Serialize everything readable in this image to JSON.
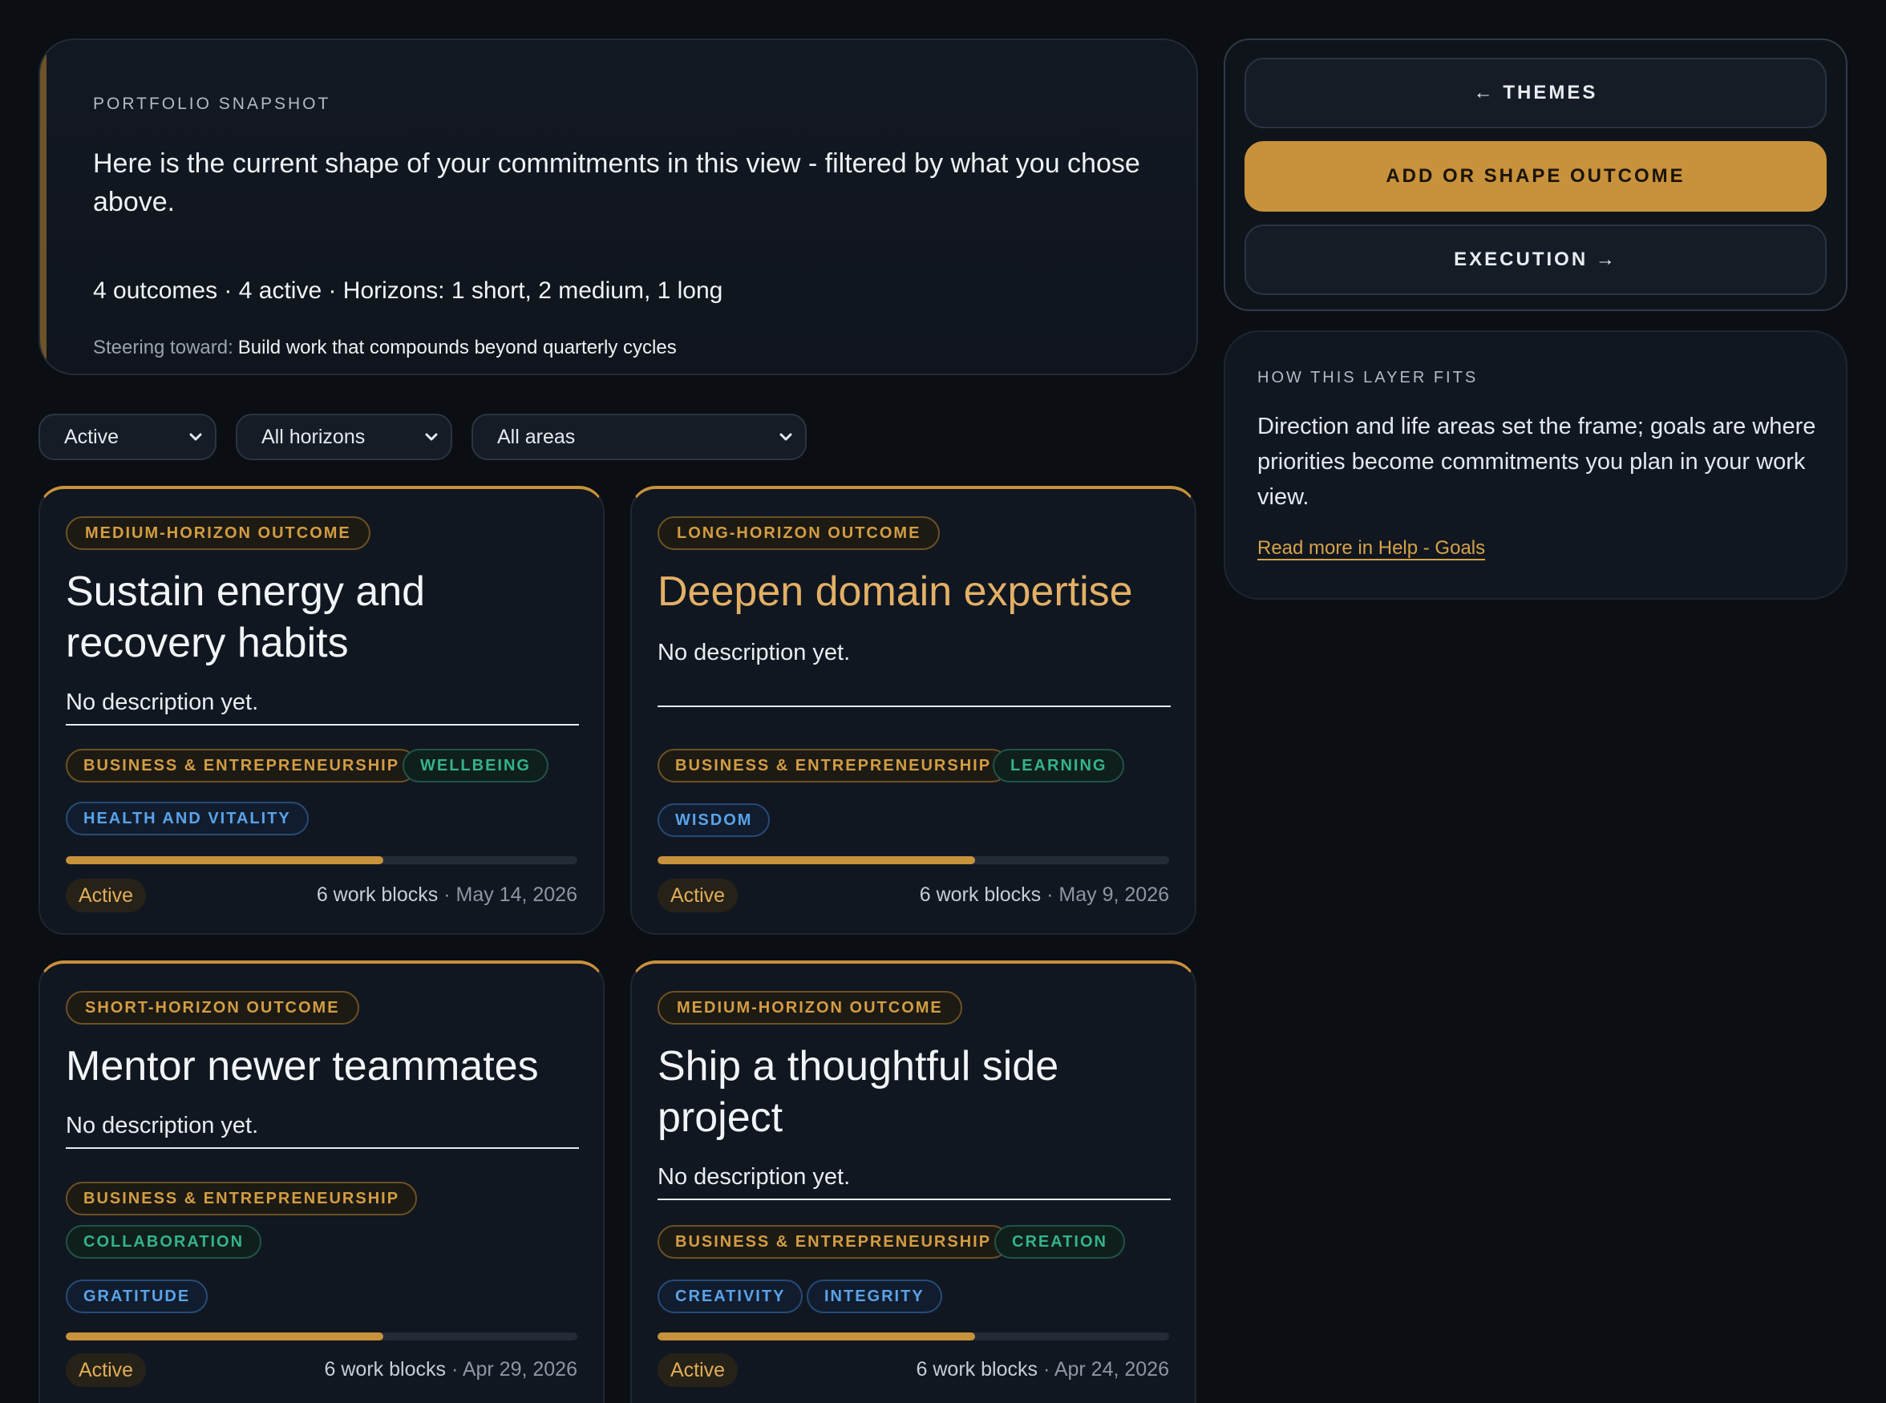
{
  "snapshot": {
    "eyebrow": "PORTFOLIO SNAPSHOT",
    "lead": "Here is the current shape of your commitments in this view - filtered by what you chose above.",
    "stats": "4 outcomes · 4 active · Horizons: 1 short, 2 medium, 1 long",
    "steer_label": "Steering toward:",
    "steer_value": "Build work that compounds beyond quarterly cycles"
  },
  "actions": {
    "themes": "← THEMES",
    "add": "ADD OR SHAPE OUTCOME",
    "execution": "EXECUTION →"
  },
  "fits": {
    "eyebrow": "HOW THIS LAYER FITS",
    "body": "Direction and life areas set the frame; goals are where priorities become commitments you plan in your work view.",
    "link": "Read more in Help - Goals"
  },
  "filters": {
    "status": "Active",
    "horizon": "All horizons",
    "area": "All areas"
  },
  "colors": {
    "accent": "#c8913b",
    "area_tag": "#d39d43",
    "focus_tag": "#34b38b",
    "value_tag": "#5aa3ea"
  },
  "cards": [
    {
      "badge": "MEDIUM-HORIZON OUTCOME",
      "title": "Sustain energy and recovery habits",
      "description": "No description yet.",
      "tags": [
        "BUSINESS & ENTREPRENEURSHIP",
        "WELLBEING",
        "HEALTH AND VITALITY"
      ],
      "progress": 0.62,
      "status": "Active",
      "blocks": "6 work blocks",
      "date": "· May 14, 2026"
    },
    {
      "badge": "LONG-HORIZON OUTCOME",
      "title": "Deepen domain expertise",
      "description": "No description yet.",
      "tags": [
        "BUSINESS & ENTREPRENEURSHIP",
        "LEARNING",
        "WISDOM"
      ],
      "progress": 0.62,
      "status": "Active",
      "blocks": "6 work blocks",
      "date": "· May 9, 2026"
    },
    {
      "badge": "SHORT-HORIZON OUTCOME",
      "title": "Mentor newer teammates",
      "description": "No description yet.",
      "tags": [
        "BUSINESS & ENTREPRENEURSHIP",
        "COLLABORATION",
        "GRATITUDE"
      ],
      "progress": 0.62,
      "status": "Active",
      "blocks": "6 work blocks",
      "date": "· Apr 29, 2026"
    },
    {
      "badge": "MEDIUM-HORIZON OUTCOME",
      "title": "Ship a thoughtful side project",
      "description": "No description yet.",
      "tags": [
        "BUSINESS & ENTREPRENEURSHIP",
        "CREATION",
        "CREATIVITY",
        "INTEGRITY"
      ],
      "progress": 0.62,
      "status": "Active",
      "blocks": "6 work blocks",
      "date": "· Apr 24, 2026"
    }
  ]
}
